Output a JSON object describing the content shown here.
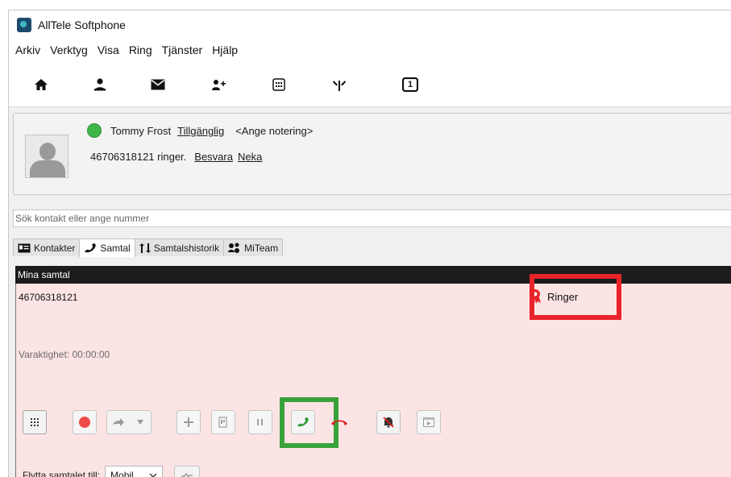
{
  "window": {
    "title": "AllTele Softphone"
  },
  "menu": [
    "Arkiv",
    "Verktyg",
    "Visa",
    "Ring",
    "Tjänster",
    "Hjälp"
  ],
  "toolbar": {
    "icons": [
      "home-icon",
      "person-icon",
      "envelope-icon",
      "add-contact-icon",
      "dialpad-icon",
      "transfer-icon",
      "number-one-icon"
    ],
    "badge_number": "1"
  },
  "status": {
    "user_name": "Tommy Frost",
    "presence": "Tillgänglig",
    "note": "<Ange notering>",
    "incoming": "46706318121 ringer.",
    "answer": "Besvara",
    "reject": "Neka",
    "presence_color": "#40b54a"
  },
  "search": {
    "placeholder": "Sök kontakt eller ange nummer"
  },
  "tabs": [
    {
      "label": "Kontakter",
      "icon": "contacts-card-icon"
    },
    {
      "label": "Samtal",
      "icon": "phone-handset-icon",
      "active": true
    },
    {
      "label": "Samtalshistorik",
      "icon": "history-arrows-icon"
    },
    {
      "label": "MiTeam",
      "icon": "team-icon"
    }
  ],
  "calls": {
    "header": "Mina samtal",
    "number": "46706318121",
    "state": "Ringer",
    "duration": "Varaktighet: 00:00:00",
    "controls": [
      "dialpad-icon",
      "record-icon",
      "forward-icon",
      "add-call-icon",
      "transfer-icon",
      "hold-icon",
      "answer-icon",
      "hangup-icon",
      "mute-icon",
      "video-icon"
    ],
    "move_label": "Flytta samtalet till:",
    "move_selected": "Mobil",
    "background": "#fde4e4"
  },
  "colors": {
    "highlight_red": "#e8242a",
    "highlight_green": "#3aa23b",
    "answer_green": "#2f9a3a",
    "hangup_red": "#e02020"
  }
}
